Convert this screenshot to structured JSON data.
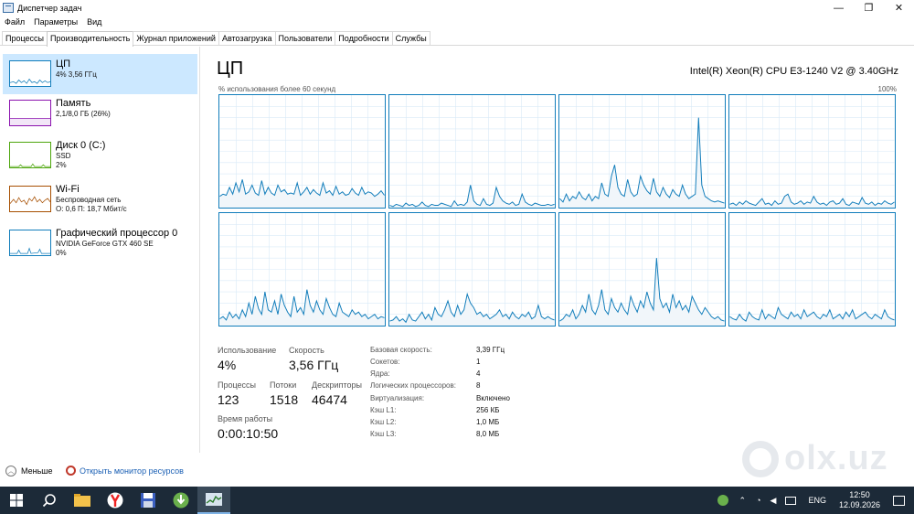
{
  "window": {
    "title": "Диспетчер задач",
    "controls": {
      "minimize": "—",
      "maximize": "❐",
      "close": "✕"
    }
  },
  "menu": [
    "Файл",
    "Параметры",
    "Вид"
  ],
  "tabs": [
    {
      "label": "Процессы",
      "active": false
    },
    {
      "label": "Производительность",
      "active": true
    },
    {
      "label": "Журнал приложений",
      "active": false
    },
    {
      "label": "Автозагрузка",
      "active": false
    },
    {
      "label": "Пользователи",
      "active": false
    },
    {
      "label": "Подробности",
      "active": false
    },
    {
      "label": "Службы",
      "active": false
    }
  ],
  "sidebar": {
    "items": [
      {
        "title": "ЦП",
        "line1": "4% 3,56 ГГц",
        "line2": "",
        "color": "#117dbb",
        "selected": true
      },
      {
        "title": "Память",
        "line1": "2,1/8,0 ГБ (26%)",
        "line2": "",
        "color": "#8b12ae",
        "selected": false
      },
      {
        "title": "Диск 0 (C:)",
        "line1": "SSD",
        "line2": "2%",
        "color": "#4da60c",
        "selected": false
      },
      {
        "title": "Wi-Fi",
        "line1": "Беспроводная сеть",
        "line2": "О: 0,6 П: 18,7 Мбит/с",
        "color": "#a74f01",
        "selected": false
      },
      {
        "title": "Графический процессор 0",
        "line1": "NVIDIA GeForce GTX 460 SE",
        "line2": "0%",
        "color": "#117dbb",
        "selected": false
      }
    ]
  },
  "main": {
    "title": "ЦП",
    "cpu_name": "Intel(R) Xeon(R) CPU E3-1240 V2 @ 3.40GHz",
    "graph_label": "% использования более 60 секунд",
    "graph_max": "100%"
  },
  "stats": {
    "usage_label": "Использование",
    "usage_value": "4%",
    "speed_label": "Скорость",
    "speed_value": "3,56 ГГц",
    "processes_label": "Процессы",
    "processes_value": "123",
    "threads_label": "Потоки",
    "threads_value": "1518",
    "handles_label": "Дескрипторы",
    "handles_value": "46474",
    "uptime_label": "Время работы",
    "uptime_value": "0:00:10:50"
  },
  "specs": [
    {
      "label": "Базовая скорость:",
      "value": "3,39 ГГц"
    },
    {
      "label": "Сокетов:",
      "value": "1"
    },
    {
      "label": "Ядра:",
      "value": "4"
    },
    {
      "label": "Логических процессоров:",
      "value": "8"
    },
    {
      "label": "Виртуализация:",
      "value": "Включено"
    },
    {
      "label": "Кэш L1:",
      "value": "256 КБ"
    },
    {
      "label": "Кэш L2:",
      "value": "1,0 МБ"
    },
    {
      "label": "Кэш L3:",
      "value": "8,0 МБ"
    }
  ],
  "footer": {
    "fewer_label": "Меньше",
    "resmon_label": "Открыть монитор ресурсов"
  },
  "watermark": "olx.uz",
  "taskbar": {
    "apps": [
      "windows-start-icon",
      "search-icon",
      "file-explorer-icon",
      "yandex-browser-icon",
      "save-icon",
      "torrent-icon",
      "task-manager-icon"
    ],
    "language": "ENG",
    "time": "12:50",
    "date": "12.09.2026"
  },
  "chart_data": {
    "type": "line",
    "title": "ЦП",
    "ylabel": "% использования более 60 секунд",
    "ylim": [
      0,
      100
    ],
    "series": [
      {
        "values": [
          10,
          12,
          11,
          18,
          12,
          22,
          14,
          25,
          12,
          14,
          20,
          13,
          11,
          24,
          12,
          18,
          13,
          11,
          20,
          14,
          16,
          12,
          13,
          12,
          22,
          11,
          14,
          18,
          12,
          16,
          13,
          11,
          22,
          13,
          15,
          11,
          19,
          12,
          14,
          11,
          12,
          17,
          13,
          11,
          18,
          12,
          14,
          13,
          10,
          12,
          15,
          11
        ]
      },
      {
        "values": [
          2,
          1,
          3,
          2,
          1,
          4,
          2,
          3,
          1,
          2,
          5,
          2,
          1,
          3,
          2,
          2,
          4,
          3,
          2,
          1,
          6,
          2,
          3,
          2,
          5,
          20,
          6,
          3,
          2,
          8,
          3,
          2,
          4,
          18,
          10,
          6,
          4,
          3,
          5,
          2,
          3,
          12,
          5,
          3,
          2,
          4,
          3,
          2,
          2,
          3,
          2,
          3
        ]
      },
      {
        "values": [
          8,
          5,
          12,
          6,
          10,
          8,
          14,
          9,
          7,
          12,
          6,
          10,
          8,
          22,
          12,
          10,
          28,
          38,
          18,
          12,
          10,
          25,
          14,
          10,
          12,
          28,
          20,
          15,
          12,
          26,
          14,
          10,
          18,
          12,
          9,
          16,
          12,
          10,
          20,
          12,
          8,
          10,
          12,
          80,
          20,
          10,
          8,
          6,
          5,
          6,
          5,
          4
        ]
      },
      {
        "values": [
          3,
          4,
          2,
          5,
          3,
          6,
          4,
          3,
          2,
          5,
          8,
          3,
          4,
          2,
          6,
          3,
          4,
          10,
          12,
          5,
          3,
          4,
          6,
          3,
          5,
          4,
          10,
          5,
          3,
          4,
          2,
          5,
          6,
          3,
          4,
          8,
          3,
          2,
          5,
          4,
          3,
          9,
          4,
          3,
          5,
          2,
          4,
          3,
          6,
          4,
          3,
          5
        ]
      },
      {
        "values": [
          6,
          8,
          5,
          12,
          7,
          10,
          6,
          14,
          8,
          20,
          10,
          26,
          15,
          10,
          30,
          14,
          12,
          22,
          10,
          28,
          18,
          12,
          8,
          26,
          12,
          16,
          10,
          32,
          18,
          12,
          22,
          14,
          10,
          24,
          16,
          10,
          8,
          20,
          12,
          10,
          8,
          14,
          10,
          12,
          8,
          10,
          6,
          8,
          10,
          6,
          8,
          7
        ]
      },
      {
        "values": [
          4,
          5,
          8,
          4,
          6,
          3,
          10,
          5,
          4,
          8,
          12,
          6,
          10,
          5,
          16,
          10,
          8,
          14,
          22,
          12,
          8,
          18,
          10,
          14,
          28,
          20,
          16,
          10,
          12,
          8,
          10,
          6,
          8,
          10,
          14,
          8,
          10,
          6,
          12,
          8,
          6,
          10,
          8,
          12,
          6,
          8,
          18,
          8,
          6,
          8,
          6,
          5
        ]
      },
      {
        "values": [
          4,
          6,
          10,
          8,
          14,
          6,
          10,
          18,
          12,
          28,
          14,
          10,
          18,
          32,
          14,
          10,
          24,
          16,
          12,
          20,
          14,
          10,
          26,
          18,
          12,
          22,
          16,
          30,
          20,
          14,
          60,
          24,
          16,
          20,
          12,
          28,
          16,
          22,
          14,
          18,
          12,
          26,
          20,
          14,
          10,
          16,
          12,
          8,
          6,
          8,
          5,
          4
        ]
      },
      {
        "values": [
          8,
          6,
          5,
          10,
          6,
          4,
          12,
          8,
          6,
          5,
          14,
          6,
          10,
          8,
          6,
          16,
          10,
          8,
          6,
          12,
          8,
          10,
          6,
          14,
          8,
          10,
          12,
          8,
          6,
          10,
          8,
          14,
          6,
          8,
          10,
          6,
          12,
          8,
          14,
          6,
          8,
          10,
          12,
          8,
          6,
          10,
          8,
          6,
          14,
          8,
          6,
          5
        ]
      }
    ]
  }
}
